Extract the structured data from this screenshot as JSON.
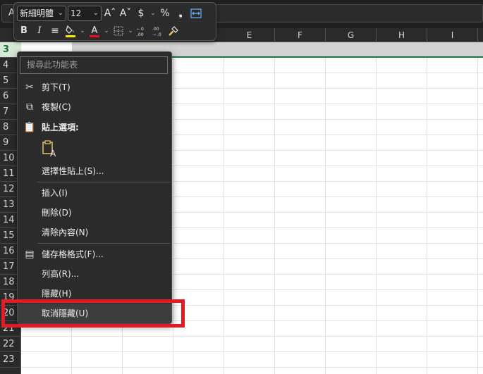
{
  "name_box": "A",
  "mini_toolbar": {
    "font_name": "新細明體",
    "font_size": "12",
    "increase_font": "Aˆ",
    "decrease_font": "Aˇ",
    "currency": "$",
    "percent": "%",
    "comma": "❟",
    "bold": "B",
    "italic": "I",
    "align": "≡",
    "font_color_label": "A"
  },
  "columns": [
    "E",
    "F",
    "G",
    "H",
    "I"
  ],
  "rows": [
    "3",
    "4",
    "5",
    "6",
    "7",
    "8",
    "9",
    "10",
    "11",
    "12",
    "13",
    "14",
    "15",
    "16",
    "17",
    "18",
    "19",
    "20",
    "21",
    "22",
    "23"
  ],
  "context_menu": {
    "search_placeholder": "搜尋此功能表",
    "items": [
      {
        "label": "剪下(T)",
        "icon": "scissors-icon"
      },
      {
        "label": "複製(C)",
        "icon": "copy-icon"
      },
      {
        "label": "貼上選項:",
        "icon": "paste-icon"
      },
      {
        "label": "選擇性貼上(S)..."
      },
      {
        "label": "插入(I)"
      },
      {
        "label": "刪除(D)"
      },
      {
        "label": "清除內容(N)"
      },
      {
        "label": "儲存格格式(F)...",
        "icon": "format-cells-icon"
      },
      {
        "label": "列高(R)..."
      },
      {
        "label": "隱藏(H)"
      },
      {
        "label": "取消隱藏(U)"
      }
    ]
  },
  "colors": {
    "accent": "#1e7145",
    "highlight_box": "#e01b24",
    "menu_bg": "#2b2b2b"
  }
}
